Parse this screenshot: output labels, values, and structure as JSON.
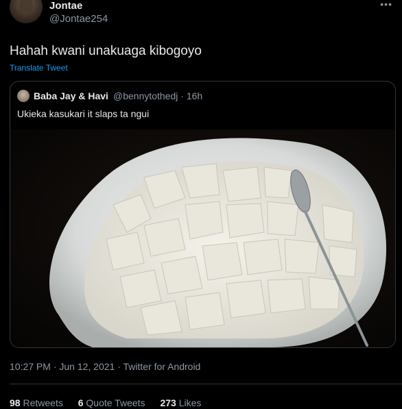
{
  "author": {
    "display_name": "Jontae",
    "handle": "@Jontae254"
  },
  "tweet": {
    "text": "Hahah kwani unakuaga kibogoyo",
    "translate_label": "Translate Tweet"
  },
  "quoted": {
    "display_name": "Baba Jay & Havi",
    "meta": "@bennytothedj · 16h",
    "text": "Ukieka kasukari it slaps ta ngui"
  },
  "timestamp": "10:27 PM · Jun 12, 2021 · Twitter for Android",
  "stats": {
    "retweets_count": "98",
    "retweets_label": "Retweets",
    "quotes_count": "6",
    "quotes_label": "Quote Tweets",
    "likes_count": "273",
    "likes_label": "Likes"
  },
  "icons": {
    "more": "more-icon"
  }
}
